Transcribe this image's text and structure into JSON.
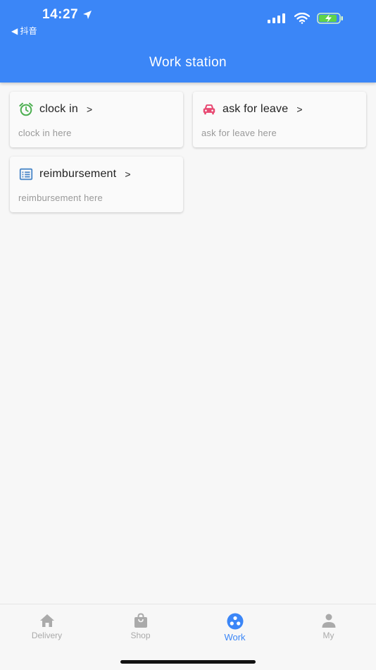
{
  "status_bar": {
    "time": "14:27",
    "back_app": "◀ 抖音"
  },
  "header": {
    "title": "Work station"
  },
  "cards": [
    {
      "title": "clock in",
      "subtitle": "clock in here",
      "icon": "alarm-clock-icon",
      "icon_color": "#4caf50"
    },
    {
      "title": "ask for leave",
      "subtitle": "ask for leave here",
      "icon": "car-icon",
      "icon_color": "#e84a73"
    },
    {
      "title": "reimbursement",
      "subtitle": "reimbursement here",
      "icon": "list-icon",
      "icon_color": "#4a87c8"
    }
  ],
  "chevron": ">",
  "bottom_nav": {
    "items": [
      {
        "label": "Delivery",
        "icon": "home-icon",
        "active": false
      },
      {
        "label": "Shop",
        "icon": "shopping-bag-icon",
        "active": false
      },
      {
        "label": "Work",
        "icon": "work-icon",
        "active": true
      },
      {
        "label": "My",
        "icon": "person-icon",
        "active": false
      }
    ]
  },
  "colors": {
    "primary": "#3b86f7",
    "inactive": "#aaaaaa"
  }
}
